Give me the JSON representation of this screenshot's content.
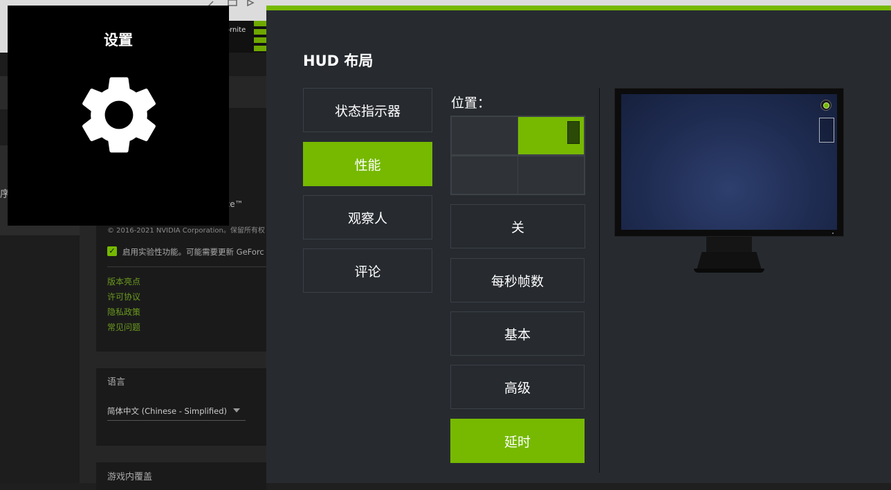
{
  "background": {
    "side_char": "序",
    "thumb_text": "ornite",
    "product_fragment": "nce™",
    "copyright": "© 2016-2021 NVIDIA Corporation。保留所有权",
    "experimental_label": "启用实验性功能。可能需要更新 GeForc",
    "experimental_checked": true,
    "links": [
      "版本亮点",
      "许可协议",
      "隐私政策",
      "常见问题"
    ],
    "language_title": "语言",
    "language_value": "简体中文 (Chinese - Simplified)",
    "overlay_title": "游戏内覆盖"
  },
  "settings_tile": {
    "title": "设置",
    "icon": "gear-icon"
  },
  "hud": {
    "title": "HUD 布局",
    "categories": [
      {
        "label": "状态指示器",
        "active": false
      },
      {
        "label": "性能",
        "active": true
      },
      {
        "label": "观察人",
        "active": false
      },
      {
        "label": "评论",
        "active": false
      }
    ],
    "position_label": "位置：",
    "selected_position": "top-right",
    "options": [
      {
        "label": "关",
        "active": false
      },
      {
        "label": "每秒帧数",
        "active": false
      },
      {
        "label": "基本",
        "active": false
      },
      {
        "label": "高级",
        "active": false
      },
      {
        "label": "延时",
        "active": true
      }
    ]
  },
  "colors": {
    "accent": "#76b900",
    "panel": "#272b30",
    "tile": "#000000"
  }
}
